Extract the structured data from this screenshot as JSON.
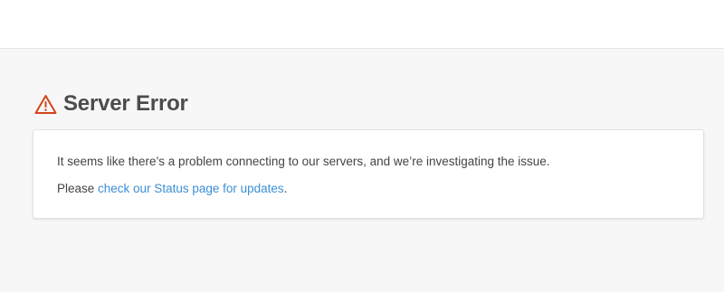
{
  "page": {
    "title": "Server Error",
    "icon": "warning-triangle-icon",
    "icon_color": "#d0451b",
    "message": "It seems like there’s a problem connecting to our servers, and we’re investigating the issue.",
    "status_prefix": "Please ",
    "status_link_text": "check our Status page for updates",
    "status_suffix": ".",
    "link_color": "#3b8fd6"
  }
}
